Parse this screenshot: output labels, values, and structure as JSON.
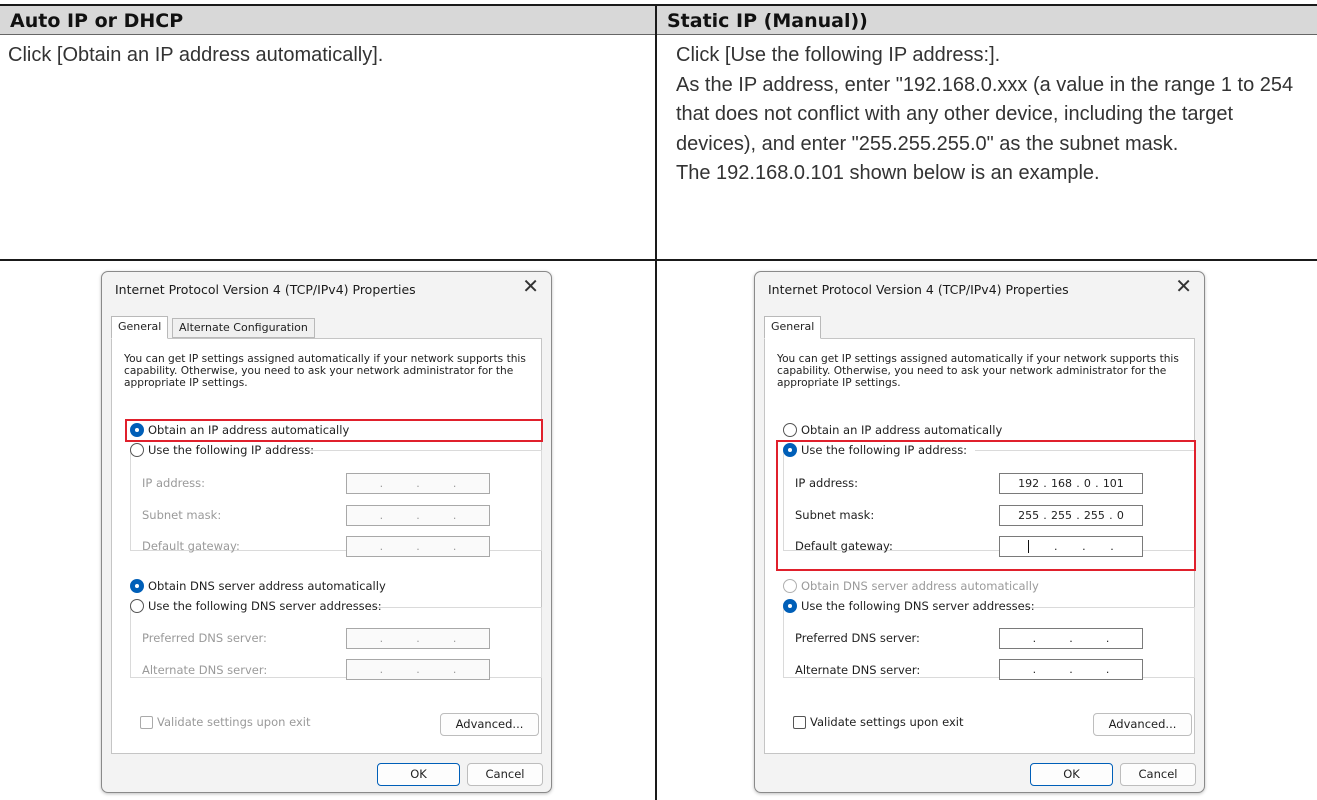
{
  "header": {
    "left": "Auto IP or DHCP",
    "right": "Static IP (Manual))"
  },
  "left_text": [
    "Click [Obtain an IP address automatically]."
  ],
  "right_text": [
    "Click [Use the following IP address:].",
    "As the IP address, enter \"192.168.0.xxx (a value in the range 1 to 254 that does not conflict with any other device, including the target devices), and enter \"255.255.255.0\" as the subnet mask.",
    "The 192.168.0.101 shown below is an example."
  ],
  "dialog": {
    "title": "Internet Protocol Version 4 (TCP/IPv4) Properties",
    "close_glyph": "✕",
    "tab_general": "General",
    "tab_alternate": "Alternate Configuration",
    "intro": "You can get IP settings assigned automatically if your network supports this capability. Otherwise, you need to ask your network administrator for the appropriate IP settings.",
    "obtain_ip_auto": "Obtain an IP address automatically",
    "use_following_ip": "Use the following IP address:",
    "ip_address_label": "IP address:",
    "subnet_mask_label": "Subnet mask:",
    "default_gateway_label": "Default gateway:",
    "obtain_dns_auto": "Obtain DNS server address automatically",
    "use_following_dns": "Use the following DNS server addresses:",
    "preferred_dns_label": "Preferred DNS server:",
    "alternate_dns_label": "Alternate DNS server:",
    "validate_label": "Validate settings upon exit",
    "advanced_button": "Advanced...",
    "ok_button": "OK",
    "cancel_button": "Cancel",
    "dot": "."
  },
  "static_values": {
    "ip": [
      "192",
      "168",
      "0",
      "101"
    ],
    "mask": [
      "255",
      "255",
      "255",
      "0"
    ]
  },
  "colors": {
    "highlight": "#e0202c",
    "accent": "#005fb8",
    "header_bg": "#d8d8d8"
  },
  "icons": {
    "close": "close-icon",
    "radio": "radio-button",
    "checkbox": "checkbox"
  }
}
